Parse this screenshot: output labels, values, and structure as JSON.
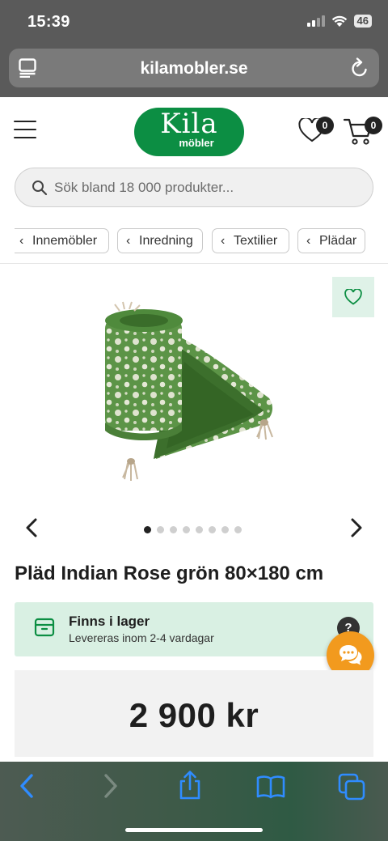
{
  "status_bar": {
    "time": "15:39",
    "battery": "46"
  },
  "browser": {
    "url": "kilamobler.se"
  },
  "header": {
    "logo_main": "Kila",
    "logo_sub": "möbler",
    "wishlist_count": "0",
    "cart_count": "0"
  },
  "search": {
    "placeholder": "Sök bland 18 000 produkter..."
  },
  "breadcrumbs": [
    "Innemöbler",
    "Inredning",
    "Textilier",
    "Plädar"
  ],
  "gallery": {
    "total_images": 8,
    "active_index": 0
  },
  "product": {
    "title": "Pläd Indian Rose grön 80×180 cm",
    "stock_title": "Finns i lager",
    "stock_sub": "Levereras inom 2-4 vardagar",
    "help": "?",
    "price": "2 900 kr"
  },
  "colors": {
    "brand_green": "#0c8e43",
    "stock_bg": "#d9f0e3",
    "chat_orange": "#f29a1e",
    "safari_blue": "#2f8cff"
  }
}
